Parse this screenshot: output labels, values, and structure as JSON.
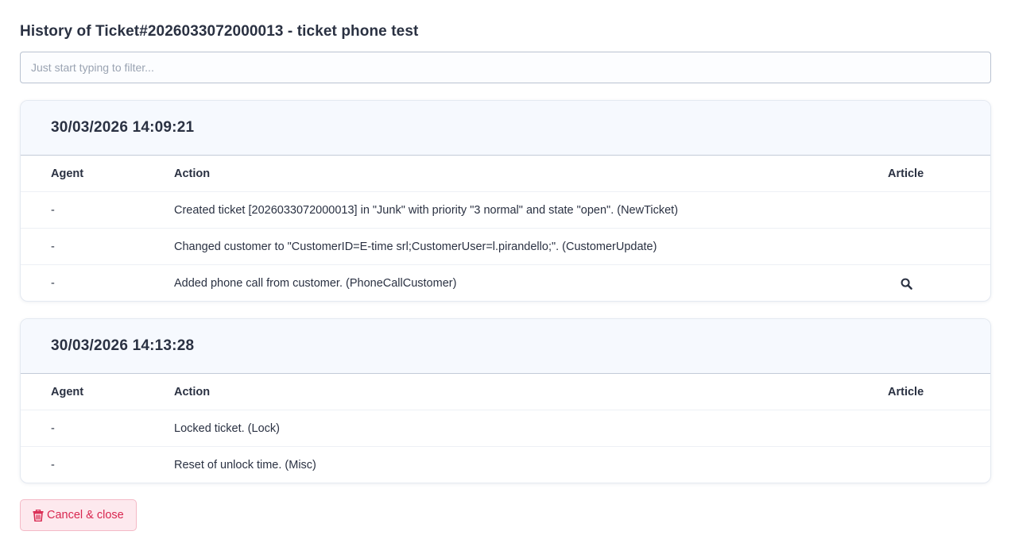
{
  "page": {
    "title": "History of Ticket#2026033072000013 - ticket phone test"
  },
  "filter": {
    "placeholder": "Just start typing to filter..."
  },
  "columns": {
    "agent": "Agent",
    "action": "Action",
    "article": "Article"
  },
  "groups": [
    {
      "timestamp": "30/03/2026 14:09:21",
      "rows": [
        {
          "agent": "-",
          "action": "Created ticket [2026033072000013] in \"Junk\" with priority \"3 normal\" and state \"open\". (NewTicket)",
          "article_icon": ""
        },
        {
          "agent": "-",
          "action": "Changed customer to \"CustomerID=E-time srl;CustomerUser=l.pirandello;\". (CustomerUpdate)",
          "article_icon": ""
        },
        {
          "agent": "-",
          "action": "Added phone call from customer. (PhoneCallCustomer)",
          "article_icon": "search-icon"
        }
      ]
    },
    {
      "timestamp": "30/03/2026 14:13:28",
      "rows": [
        {
          "agent": "-",
          "action": "Locked ticket. (Lock)",
          "article_icon": ""
        },
        {
          "agent": "-",
          "action": "Reset of unlock time. (Misc)",
          "article_icon": ""
        }
      ]
    }
  ],
  "footer": {
    "cancel_label": "Cancel & close",
    "cancel_icon": "trash-icon"
  },
  "colors": {
    "danger": "#d8264f",
    "danger_bg": "#fde9ee",
    "header_bg": "#f6f9fe",
    "text": "#2a3142"
  }
}
